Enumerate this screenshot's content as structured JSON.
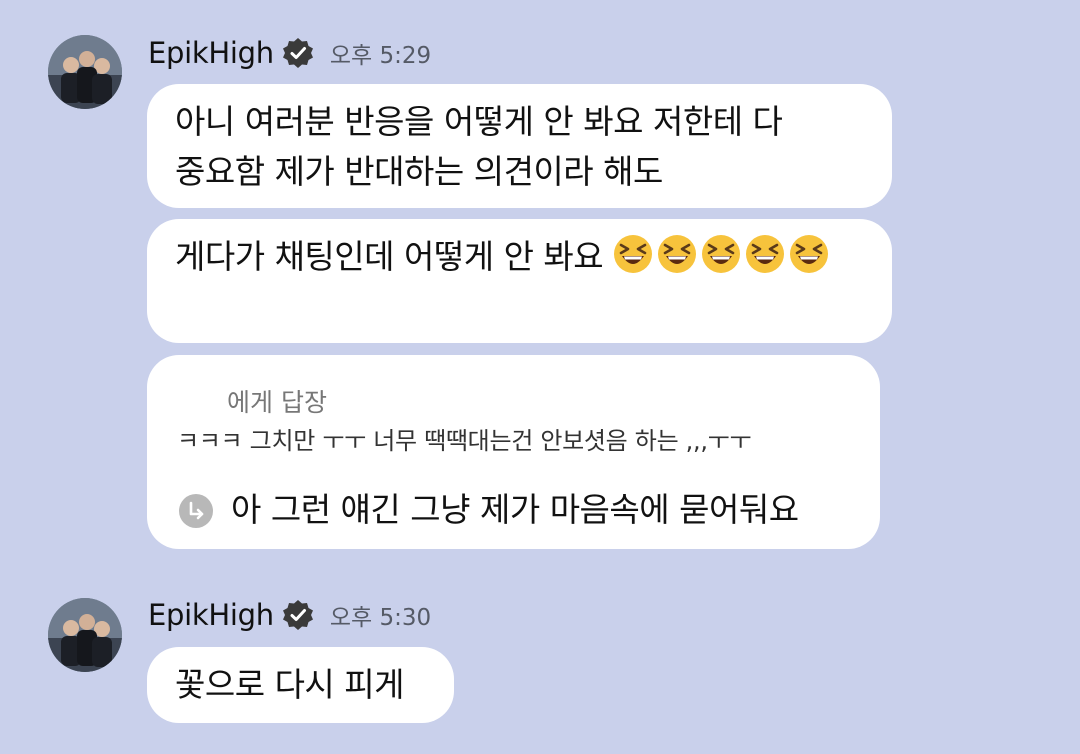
{
  "messages": [
    {
      "sender": "EpikHigh",
      "time": "오후 5:29",
      "bubbles": [
        {
          "text": "아니 여러분 반응을 어떻게 안 봐요 저한테 다\n중요함 제가 반대하는 의견이라 해도"
        },
        {
          "text": "게다가 채팅인데 어떻게 안 봐요 ",
          "emoji": "grinning-squinting-face",
          "emoji_count": 5
        },
        {
          "reply_label": "에게 답장",
          "reply_quote": "ㅋㅋㅋ 그치만 ㅜㅜ 너무 땍땍대는건 안보셧음 하는 ,,,ㅜㅜ",
          "text": "아 그런 얘긴 그냥 제가 마음속에 묻어둬요"
        }
      ]
    },
    {
      "sender": "EpikHigh",
      "time": "오후 5:30",
      "bubbles": [
        {
          "text": "꽃으로 다시 피게"
        }
      ]
    }
  ],
  "colors": {
    "background": "#c9d0eb",
    "bubble": "#ffffff",
    "verified_badge": "#3a3a3a",
    "time_text": "#555a66"
  },
  "icons": [
    "avatar",
    "verified-badge-icon",
    "reply-arrow-icon",
    "grinning-squinting-face-emoji"
  ]
}
